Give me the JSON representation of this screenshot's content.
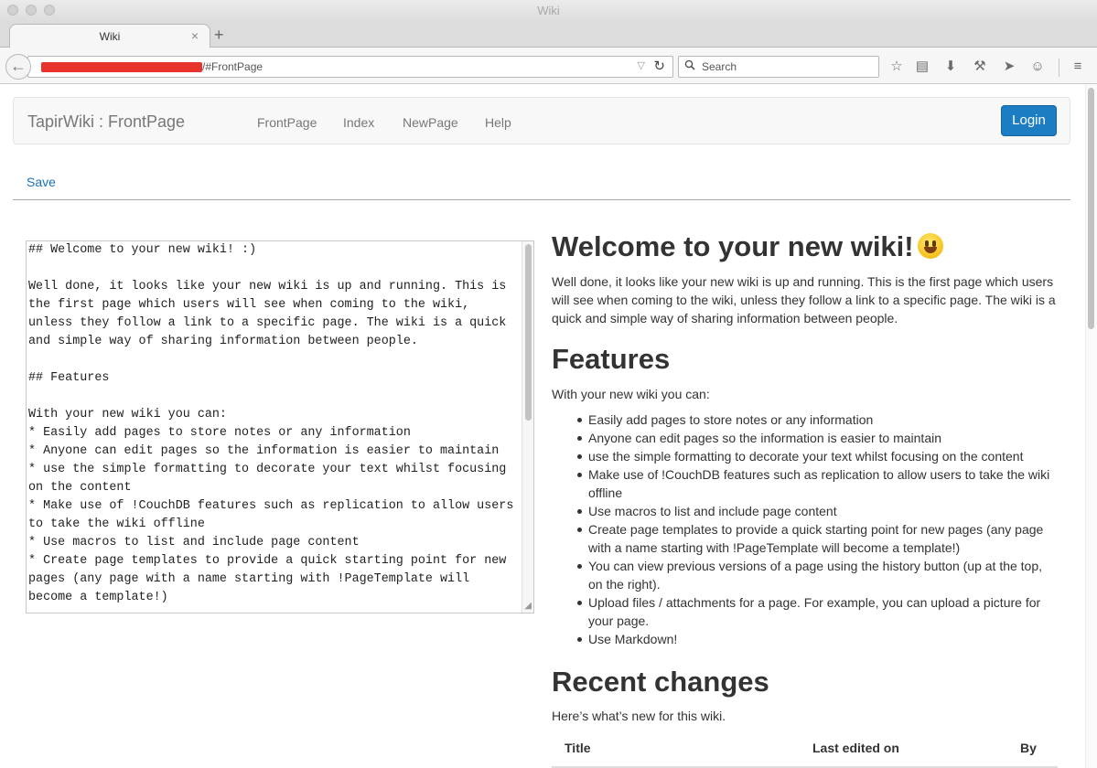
{
  "window": {
    "title": "Wiki"
  },
  "tab": {
    "title": "Wiki",
    "close": "×",
    "new_tab": "+"
  },
  "address": {
    "url": "/#FrontPage"
  },
  "search": {
    "placeholder": "Search"
  },
  "site": {
    "brand": "TapirWiki : FrontPage",
    "nav": [
      "FrontPage",
      "Index",
      "NewPage",
      "Help"
    ],
    "login": "Login",
    "save": "Save"
  },
  "editor": {
    "source": "## Welcome to your new wiki! :)\n\nWell done, it looks like your new wiki is up and running. This is the first page which users will see when coming to the wiki, unless they follow a link to a specific page. The wiki is a quick and simple way of sharing information between people.\n\n## Features\n\nWith your new wiki you can:\n* Easily add pages to store notes or any information\n* Anyone can edit pages so the information is easier to maintain\n* use the simple formatting to decorate your text whilst focusing on the content\n* Make use of !CouchDB features such as replication to allow users to take the wiki offline\n* Use macros to list and include page content\n* Create page templates to provide a quick starting point for new pages (any page with a name starting with !PageTemplate will become a template!)"
  },
  "preview": {
    "heading": "Welcome to your new wiki!",
    "intro": "Well done, it looks like your new wiki is up and running. This is the first page which users will see when coming to the wiki, unless they follow a link to a specific page. The wiki is a quick and simple way of sharing information between people.",
    "features_heading": "Features",
    "features_intro": "With your new wiki you can:",
    "features": [
      "Easily add pages to store notes or any information",
      "Anyone can edit pages so the information is easier to maintain",
      "use the simple formatting to decorate your text whilst focusing on the content",
      "Make use of !CouchDB features such as replication to allow users to take the wiki offline",
      "Use macros to list and include page content",
      "Create page templates to provide a quick starting point for new pages (any page with a name starting with !PageTemplate will become a template!)",
      "You can view previous versions of a page using the history button (up at the top, on the right).",
      "Upload files / attachments for a page. For example, you can upload a picture for your page.",
      "Use Markdown!"
    ],
    "recent_heading": "Recent changes",
    "recent_intro": "Here’s what’s new for this wiki.",
    "table_headers": {
      "title": "Title",
      "edited": "Last edited on",
      "by": "By"
    }
  },
  "colors": {
    "accent": "#1c7dc2",
    "link": "#1a72b8",
    "redaction": "#e8332c"
  },
  "icons": [
    "back-icon",
    "dropdown-icon",
    "reload-icon",
    "search-icon",
    "bookmark-star-icon",
    "reading-list-icon",
    "download-icon",
    "wrench-icon",
    "send-icon",
    "chat-icon",
    "menu-icon",
    "smiley-icon",
    "resize-handle-icon"
  ]
}
